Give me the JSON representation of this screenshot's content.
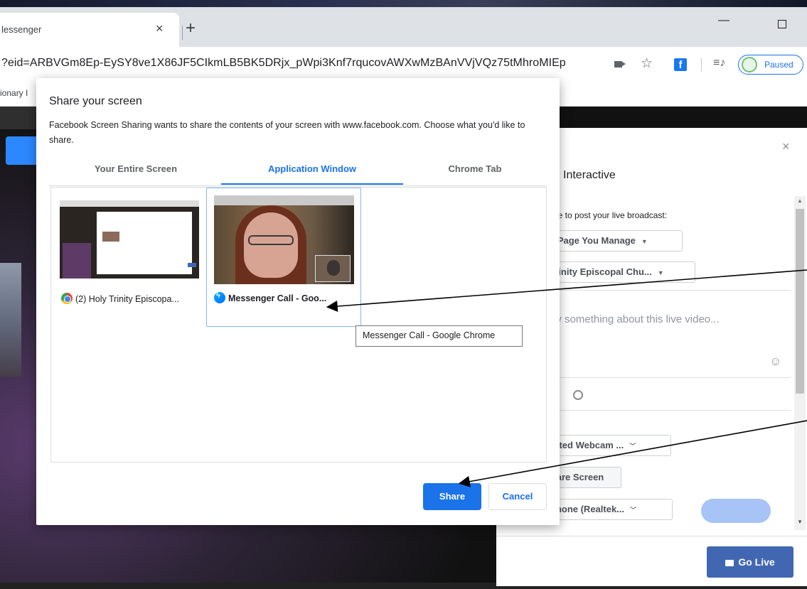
{
  "browser": {
    "tab_title": "lessenger",
    "tab_close": "×",
    "new_tab": "+",
    "minimize": "—",
    "url": "?eid=ARBVGm8Ep-EySY8ve1X86JF5CIkmLB5BK5DRjx_pWpi3Knf7rqucovAWXwMzBAnVVjVQz75tMhroMIEp",
    "star": "☆",
    "fb_letter": "f",
    "queue": "≡♪",
    "paused_label": "Paused",
    "bookmark": "ionary I"
  },
  "dialog": {
    "title": "Share your screen",
    "description": "Facebook Screen Sharing wants to share the contents of your screen with www.facebook.com. Choose what you'd like to share.",
    "tabs": [
      "Your Entire Screen",
      "Application Window",
      "Chrome Tab"
    ],
    "active_tab": "Application Window",
    "windows": [
      {
        "label": "(2) Holy Trinity Episcopa...",
        "icon": "chrome-icon"
      },
      {
        "label": "Messenger Call - Goo...",
        "icon": "messenger-icon",
        "selected": true
      }
    ],
    "tooltip": "Messenger Call - Google Chrome",
    "share_label": "Share",
    "cancel_label": "Cancel"
  },
  "live_panel": {
    "close": "×",
    "tab_label": "Interactive",
    "where_label": "ere to post your live broadcast:",
    "page_select": "a Page You Manage",
    "page_name": "Trinity Episcopal Chu...",
    "say_placeholder": "ay something about this live video...",
    "webcam": "egrated Webcam ...",
    "share_screen": "are Screen",
    "microphone": "rophone (Realtek...",
    "go_live": "Go Live"
  },
  "colors": {
    "accent": "#1a73e8",
    "go_live": "#4267b2",
    "facebook": "#1877f2"
  }
}
